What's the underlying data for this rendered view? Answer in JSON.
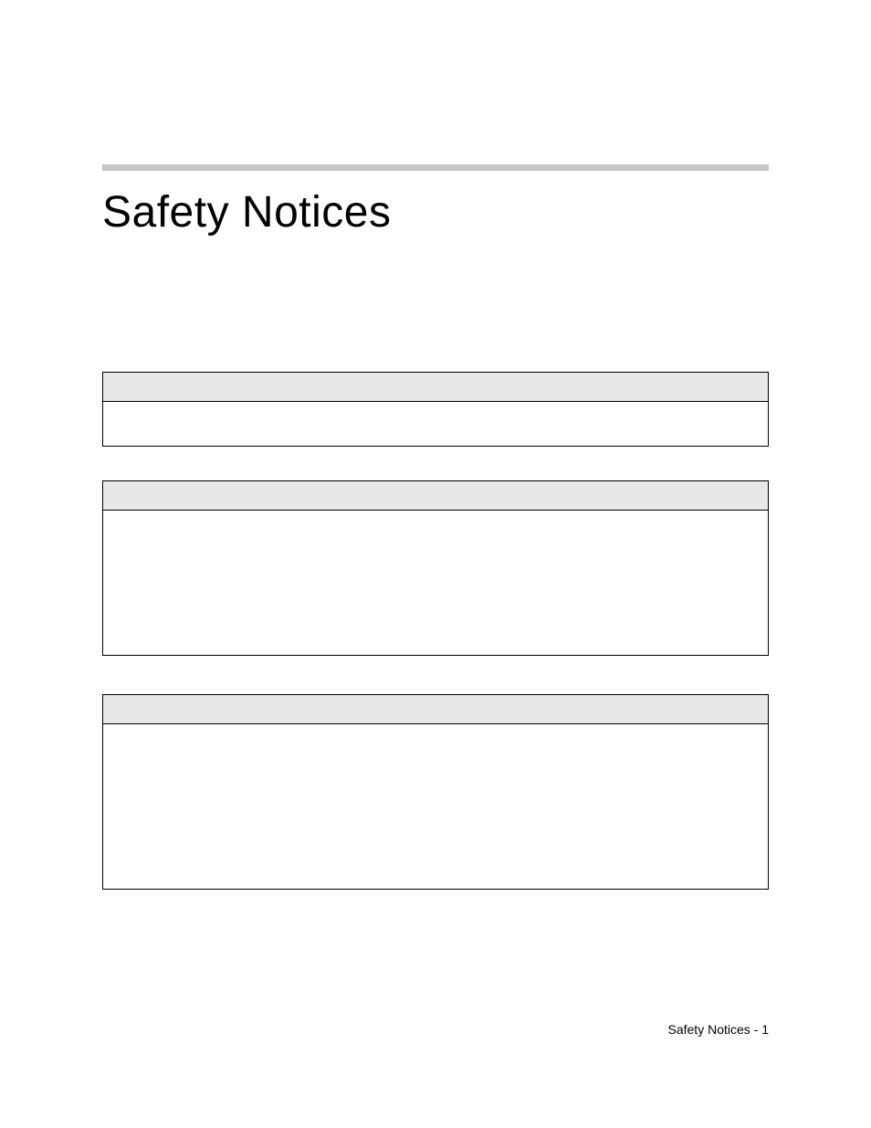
{
  "title": "Safety Notices",
  "notices": [
    {
      "header": "",
      "body": ""
    },
    {
      "header": "",
      "body": ""
    },
    {
      "header": "",
      "body": ""
    }
  ],
  "footer": "Safety Notices - 1"
}
